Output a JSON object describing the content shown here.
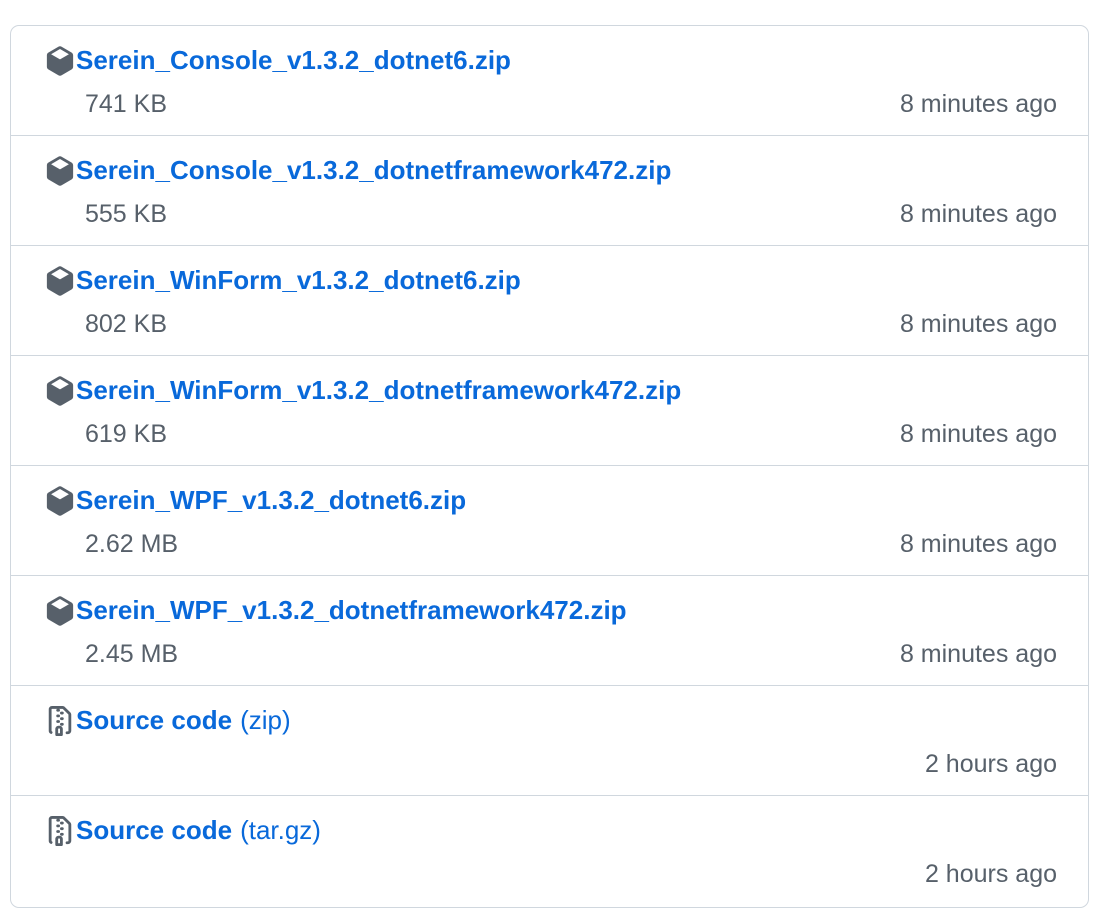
{
  "colors": {
    "link": "#0969da",
    "muted": "#57606a",
    "border": "#d0d7de"
  },
  "assets": [
    {
      "icon": "package-icon",
      "name": "Serein_Console_v1.3.2_dotnet6.zip",
      "size": "741 KB",
      "time": "8 minutes ago"
    },
    {
      "icon": "package-icon",
      "name": "Serein_Console_v1.3.2_dotnetframework472.zip",
      "size": "555 KB",
      "time": "8 minutes ago"
    },
    {
      "icon": "package-icon",
      "name": "Serein_WinForm_v1.3.2_dotnet6.zip",
      "size": "802 KB",
      "time": "8 minutes ago"
    },
    {
      "icon": "package-icon",
      "name": "Serein_WinForm_v1.3.2_dotnetframework472.zip",
      "size": "619 KB",
      "time": "8 minutes ago"
    },
    {
      "icon": "package-icon",
      "name": "Serein_WPF_v1.3.2_dotnet6.zip",
      "size": "2.62 MB",
      "time": "8 minutes ago"
    },
    {
      "icon": "package-icon",
      "name": "Serein_WPF_v1.3.2_dotnetframework472.zip",
      "size": "2.45 MB",
      "time": "8 minutes ago"
    },
    {
      "icon": "file-zip-icon",
      "name": "Source code",
      "suffix": "(zip)",
      "time": "2 hours ago"
    },
    {
      "icon": "file-zip-icon",
      "name": "Source code",
      "suffix": "(tar.gz)",
      "time": "2 hours ago"
    }
  ]
}
